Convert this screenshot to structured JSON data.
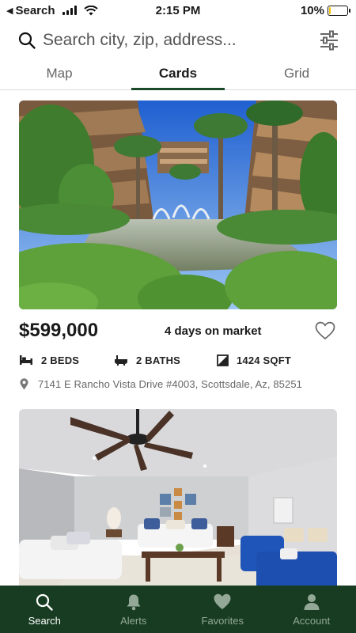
{
  "status_bar": {
    "back_label": "Search",
    "time": "2:15 PM",
    "battery": "10%",
    "battery_level": 0.1
  },
  "search": {
    "placeholder": "Search city, zip, address...",
    "icon": "search-icon",
    "filter_icon": "sliders-icon"
  },
  "tabs": [
    {
      "label": "Map",
      "active": false
    },
    {
      "label": "Cards",
      "active": true
    },
    {
      "label": "Grid",
      "active": false
    }
  ],
  "listings": [
    {
      "price": "$599,000",
      "days_on_market": "4 days on market",
      "beds": "2 BEDS",
      "baths": "2 BATHS",
      "sqft": "1424 SQFT",
      "address": "7141 E Rancho Vista Drive #4003, Scottsdale, Az, 85251",
      "favorited": false
    },
    {
      "price": "",
      "days_on_market": "",
      "beds": "",
      "baths": "",
      "sqft": "",
      "address": "",
      "favorited": false
    }
  ],
  "bottom_nav": [
    {
      "label": "Search",
      "icon": "search-icon",
      "active": true
    },
    {
      "label": "Alerts",
      "icon": "bell-icon",
      "active": false
    },
    {
      "label": "Favorites",
      "icon": "heart-icon",
      "active": false
    },
    {
      "label": "Account",
      "icon": "user-icon",
      "active": false
    }
  ],
  "colors": {
    "brand_green": "#173c22",
    "tab_underline": "#1a4a2a",
    "battery": "#f5c400"
  }
}
